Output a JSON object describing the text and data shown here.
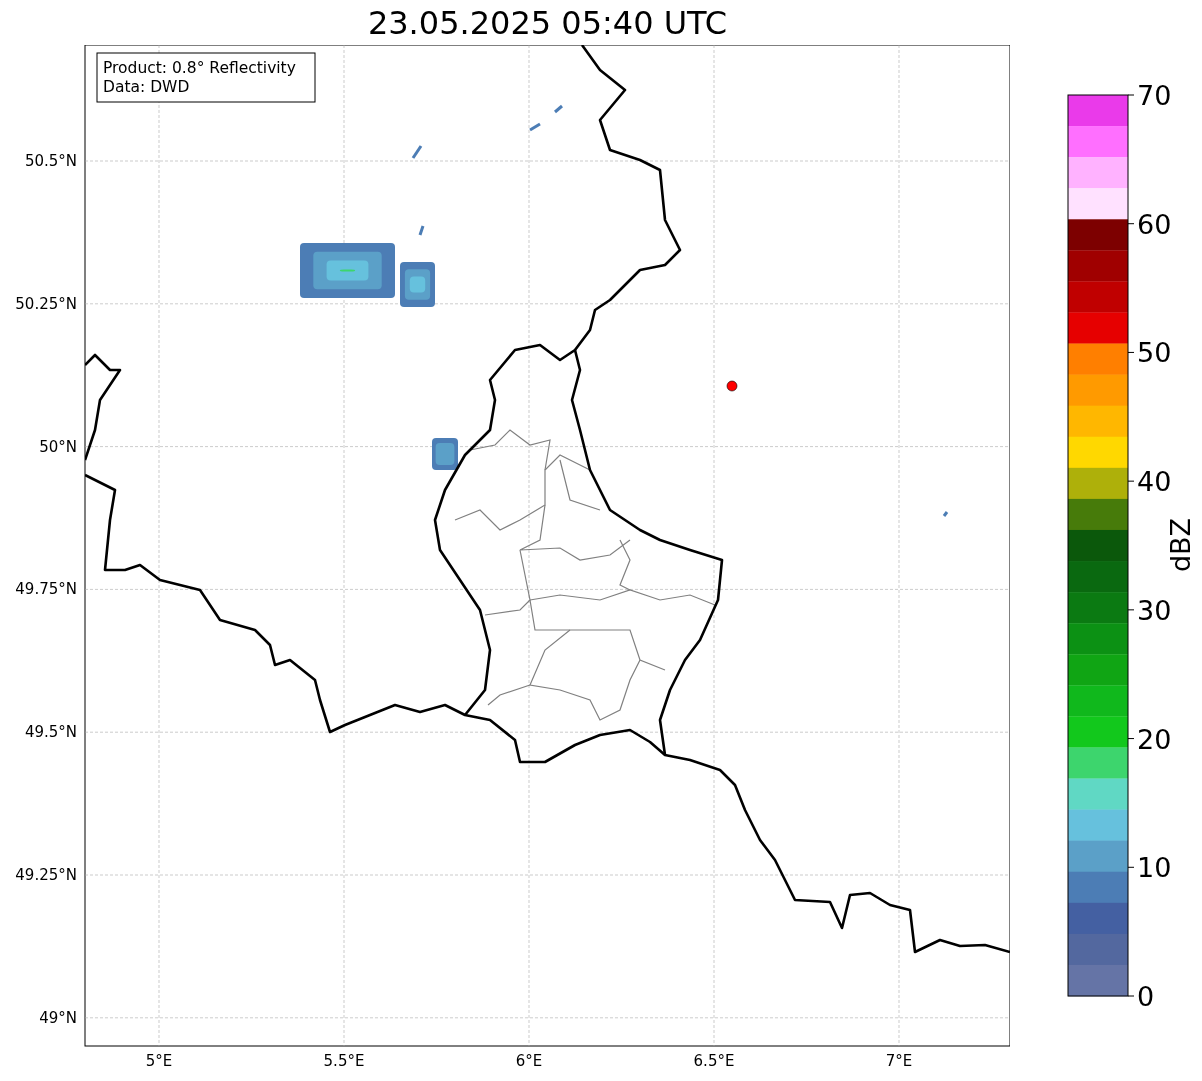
{
  "title": "23.05.2025 05:40 UTC",
  "map": {
    "info_box": [
      "Product: 0.8° Reflectivity",
      "Data: DWD"
    ],
    "x_tick_labels": [
      "5°E",
      "5.5°E",
      "6°E",
      "6.5°E",
      "7°E"
    ],
    "y_tick_labels": [
      "50.5°N",
      "50.25°N",
      "50°N",
      "49.75°N",
      "49.5°N",
      "49.25°N",
      "49°N"
    ]
  },
  "colorbar": {
    "label": "dBZ",
    "tick_labels": [
      "70",
      "60",
      "50",
      "40",
      "30",
      "20",
      "10",
      "0"
    ],
    "bands": [
      {
        "color": "#ea3aea"
      },
      {
        "color": "#ff6fff"
      },
      {
        "color": "#ffb2ff"
      },
      {
        "color": "#ffe1ff"
      },
      {
        "color": "#7d0000"
      },
      {
        "color": "#a00000"
      },
      {
        "color": "#c00000"
      },
      {
        "color": "#e60000"
      },
      {
        "color": "#ff7f00"
      },
      {
        "color": "#ff9a00"
      },
      {
        "color": "#ffb700"
      },
      {
        "color": "#ffd800"
      },
      {
        "color": "#aeb00a"
      },
      {
        "color": "#477b0a"
      },
      {
        "color": "#0b580b"
      },
      {
        "color": "#0a6910"
      },
      {
        "color": "#0b7a12"
      },
      {
        "color": "#0c9114"
      },
      {
        "color": "#10a514"
      },
      {
        "color": "#10b81c"
      },
      {
        "color": "#12c81c"
      },
      {
        "color": "#3dd56d"
      },
      {
        "color": "#60d8c4"
      },
      {
        "color": "#66c1dd"
      },
      {
        "color": "#5ba0c8"
      },
      {
        "color": "#4c7db5"
      },
      {
        "color": "#4460a2"
      },
      {
        "color": "#53689f"
      },
      {
        "color": "#6574a6"
      }
    ]
  }
}
